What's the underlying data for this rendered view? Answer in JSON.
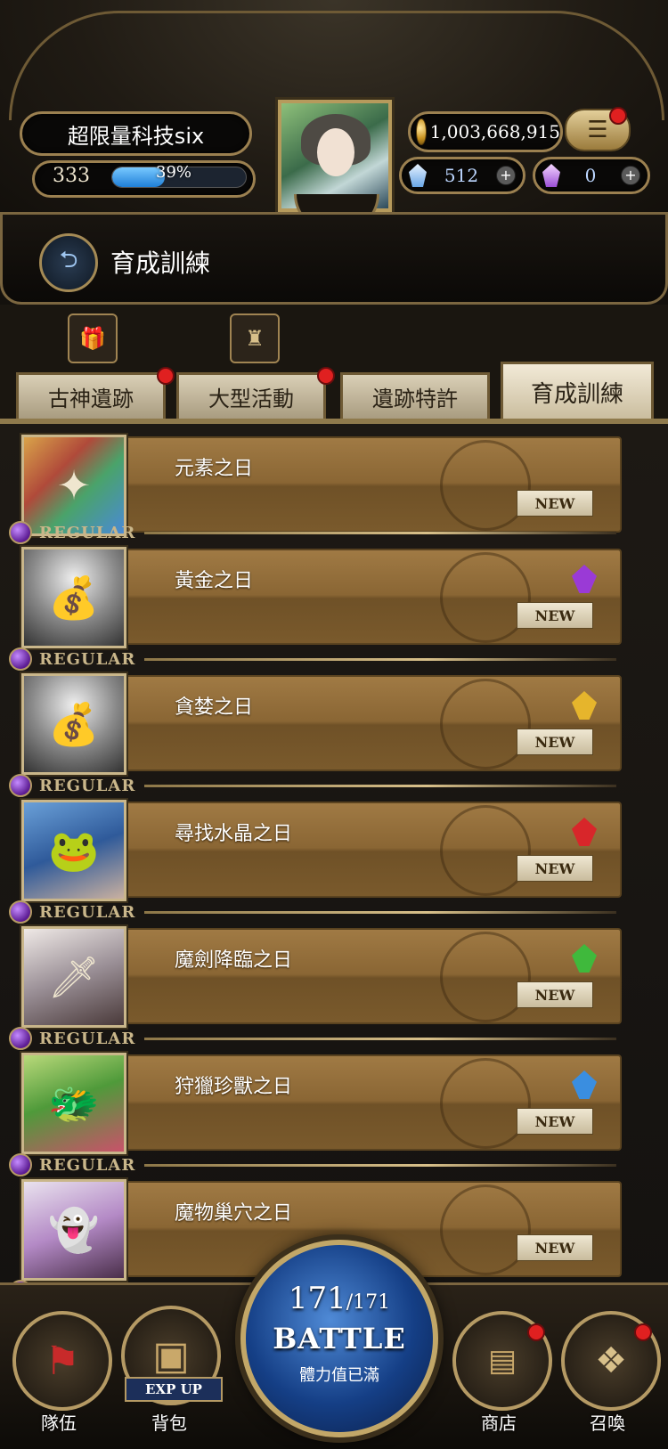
{
  "header": {
    "player_name": "超限量科技six",
    "level": "333",
    "exp_percent": "39%",
    "exp_fraction": 0.39,
    "gold": "1,003,668,915",
    "gems": "512",
    "crystals": "0",
    "menu_icon": "hamburger-icon"
  },
  "page": {
    "title": "育成訓練",
    "back_icon": "back-arrow-icon"
  },
  "tabs": [
    {
      "label": "古神遺跡",
      "badge": true,
      "active": false
    },
    {
      "label": "大型活動",
      "badge": true,
      "active": false
    },
    {
      "label": "遺跡特許",
      "badge": false,
      "active": false
    },
    {
      "label": "育成訓練",
      "badge": false,
      "active": true
    }
  ],
  "list": {
    "tag_label": "REGULAR",
    "new_label": "NEW",
    "items": [
      {
        "name": "元素之日",
        "element": "none",
        "element_color": ""
      },
      {
        "name": "黃金之日",
        "element": "dark",
        "element_color": "#9a3ad6"
      },
      {
        "name": "貪婪之日",
        "element": "light",
        "element_color": "#e6b52c"
      },
      {
        "name": "尋找水晶之日",
        "element": "fire",
        "element_color": "#d8262a"
      },
      {
        "name": "魔劍降臨之日",
        "element": "wind",
        "element_color": "#3fb93c"
      },
      {
        "name": "狩獵珍獸之日",
        "element": "water",
        "element_color": "#3a8ee0"
      },
      {
        "name": "魔物巢穴之日",
        "element": "none",
        "element_color": ""
      }
    ]
  },
  "nav": {
    "party": "隊伍",
    "bag": "背包",
    "exp_up": "EXP UP",
    "shop": "商店",
    "summon": "召喚"
  },
  "battle": {
    "stamina_current": "171",
    "stamina_max": "/171",
    "label": "BATTLE",
    "sublabel": "體力值已滿"
  },
  "colors": {
    "accent_gold": "#b59a64",
    "notification_red": "#e02020",
    "exp_blue": "#1f7fd8"
  }
}
